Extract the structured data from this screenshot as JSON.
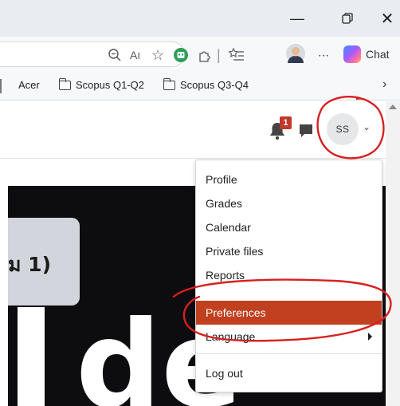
{
  "window": {
    "minimize_icon": "minimize-icon",
    "restore_icon": "restore-icon",
    "close_icon": "close-icon"
  },
  "toolbar": {
    "chat_label": "Chat"
  },
  "bookmarks": {
    "items": [
      {
        "label": "Acer"
      },
      {
        "label": "Scopus Q1-Q2"
      },
      {
        "label": "Scopus Q3-Q4"
      }
    ]
  },
  "header": {
    "notification_count": "1",
    "avatar_initials": "SS"
  },
  "banner": {
    "title_text": "ม 1)",
    "big_text": "de"
  },
  "user_menu": {
    "items": [
      {
        "label": "Profile"
      },
      {
        "label": "Grades"
      },
      {
        "label": "Calendar"
      },
      {
        "label": "Private files"
      },
      {
        "label": "Reports"
      },
      {
        "label": "Preferences"
      },
      {
        "label": "Language"
      },
      {
        "label": "Log out"
      }
    ],
    "active_item": "Preferences",
    "active_color": "#c0401f"
  },
  "annotation": {
    "stroke_color": "#d62020"
  }
}
